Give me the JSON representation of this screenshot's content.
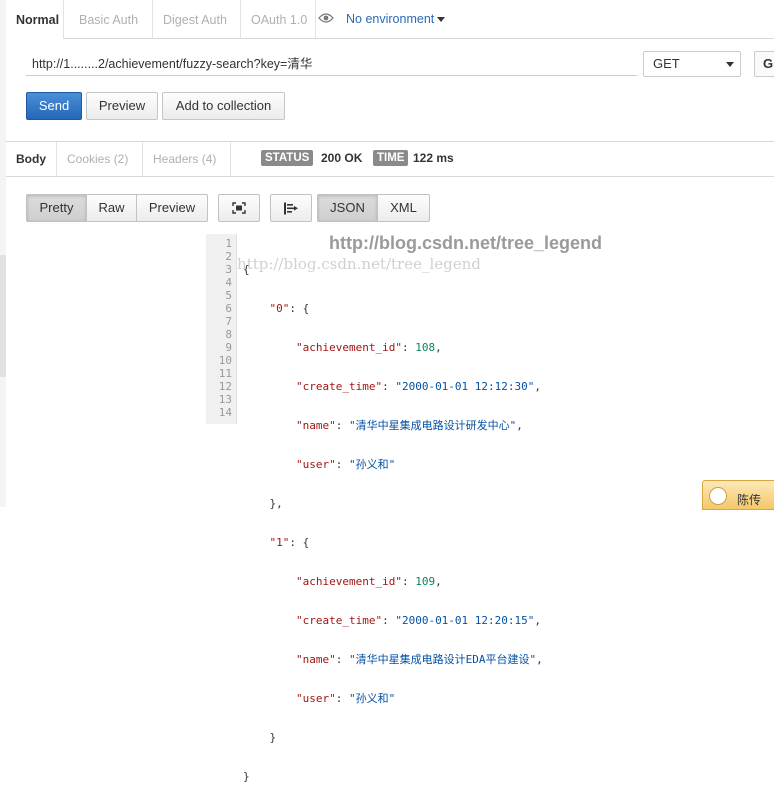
{
  "auth_tabs": [
    "Normal",
    "Basic Auth",
    "Digest Auth",
    "OAuth 1.0"
  ],
  "environment": "No environment",
  "request": {
    "url": "http://1........2/achievement/fuzzy-search?key=清华",
    "method": "GET",
    "extra_button": "G"
  },
  "actions": {
    "send": "Send",
    "preview": "Preview",
    "add_to_collection": "Add to collection"
  },
  "response_tabs": [
    "Body",
    "Cookies (2)",
    "Headers (4)"
  ],
  "status": {
    "label": "STATUS",
    "value": "200 OK"
  },
  "time": {
    "label": "TIME",
    "value": "122 ms"
  },
  "view_modes": [
    "Pretty",
    "Raw",
    "Preview"
  ],
  "format_modes": [
    "JSON",
    "XML"
  ],
  "line_numbers": [
    "1",
    "2",
    "3",
    "4",
    "5",
    "6",
    "7",
    "8",
    "9",
    "10",
    "11",
    "12",
    "13",
    "14"
  ],
  "json_body": {
    "open": "{",
    "close": "}",
    "records": [
      {
        "index": "\"0\"",
        "achievement_id": "108",
        "create_time": "\"2000-01-01 12:12:30\"",
        "name": "\"清华中星集成电路设计研发中心\"",
        "user": "\"孙义和\""
      },
      {
        "index": "\"1\"",
        "achievement_id": "109",
        "create_time": "\"2000-01-01 12:20:15\"",
        "name": "\"清华中星集成电路设计EDA平台建设\"",
        "user": "\"孙义和\""
      }
    ],
    "keys": {
      "achievement_id": "\"achievement_id\"",
      "create_time": "\"create_time\"",
      "name": "\"name\"",
      "user": "\"user\""
    }
  },
  "watermark": {
    "big": "http://blog.csdn.net/tree_legend",
    "small": "http://blog.csdn.net/tree_legend"
  },
  "chat": {
    "name": "陈传"
  },
  "colors": {
    "accent": "#2467b8",
    "badge": "#8a8a8a",
    "chat": "#f5c76a"
  }
}
